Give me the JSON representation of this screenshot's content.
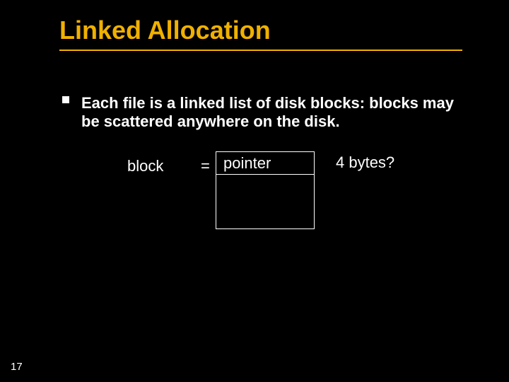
{
  "title": "Linked Allocation",
  "bullet": {
    "text": "Each file is a linked list of disk blocks: blocks may be scattered anywhere on the disk."
  },
  "diagram": {
    "block_label": "block",
    "equals": "=",
    "pointer_label": "pointer",
    "annotation": "4 bytes?"
  },
  "slide_number": "17"
}
